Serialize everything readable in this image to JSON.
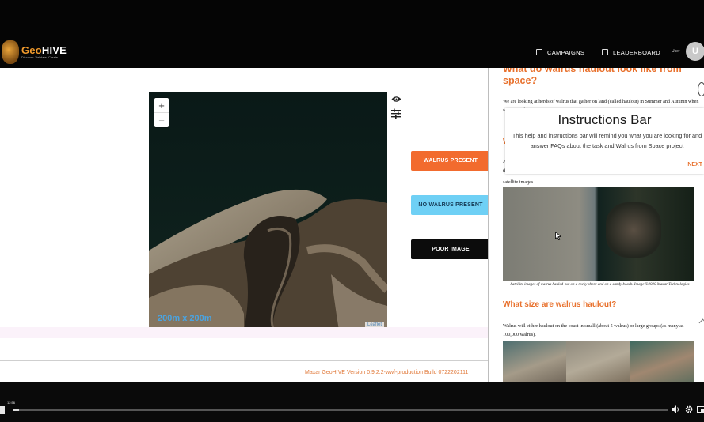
{
  "app": {
    "logo": {
      "title_prefix": "Geo",
      "title_suffix": "HIVE",
      "tagline": "Discover. Validate. Create."
    },
    "nav": {
      "campaigns": "CAMPAIGNS",
      "leaderboard": "LEADERBOARD"
    },
    "user": {
      "label": "User",
      "avatar_letter": "U"
    }
  },
  "map": {
    "zoom_in": "+",
    "zoom_out": "−",
    "scale_text": "200m x 200m",
    "attribution": "Leaflet"
  },
  "actions": {
    "walrus": "WALRUS PRESENT",
    "no_walrus": "NO WALRUS PRESENT",
    "poor": "POOR IMAGE"
  },
  "footer": {
    "text": "Maxar GeoHIVE Version 0.9.2.2-wwf-production Build 0722202111"
  },
  "panel": {
    "heading": "What do walrus haulout look like from space?",
    "intro": "We are looking at herds of walrus that gather on land (called haulout) in Summer and Autumn when sea ice is absent.",
    "partial_heading": "W",
    "partial_text_a": "A",
    "partial_text_b": "th",
    "satellite_line": "satellite images.",
    "caption": "Satellite images of walrus hauled-out on a rocky shore and on a sandy beach. Image ©2020 Maxar Technologies",
    "size_heading": "What size are walrus haulout?",
    "size_text": "Walrus will either haulout on the coast in small (about 5 walrus) or large groups (as many as 100,000 walrus)."
  },
  "instructions": {
    "title": "Instructions Bar",
    "body": "This help and instructions bar will remind you what you are looking for and answer FAQs about the task and Walrus from Space project",
    "next": "NEXT"
  },
  "video": {
    "time": "12:56",
    "progress": 0.01
  },
  "colors": {
    "accent": "#e8712d",
    "walrus_button": "#f26b2e",
    "no_walrus_button": "#6fd0f5",
    "poor_button": "#0c0c0c"
  }
}
